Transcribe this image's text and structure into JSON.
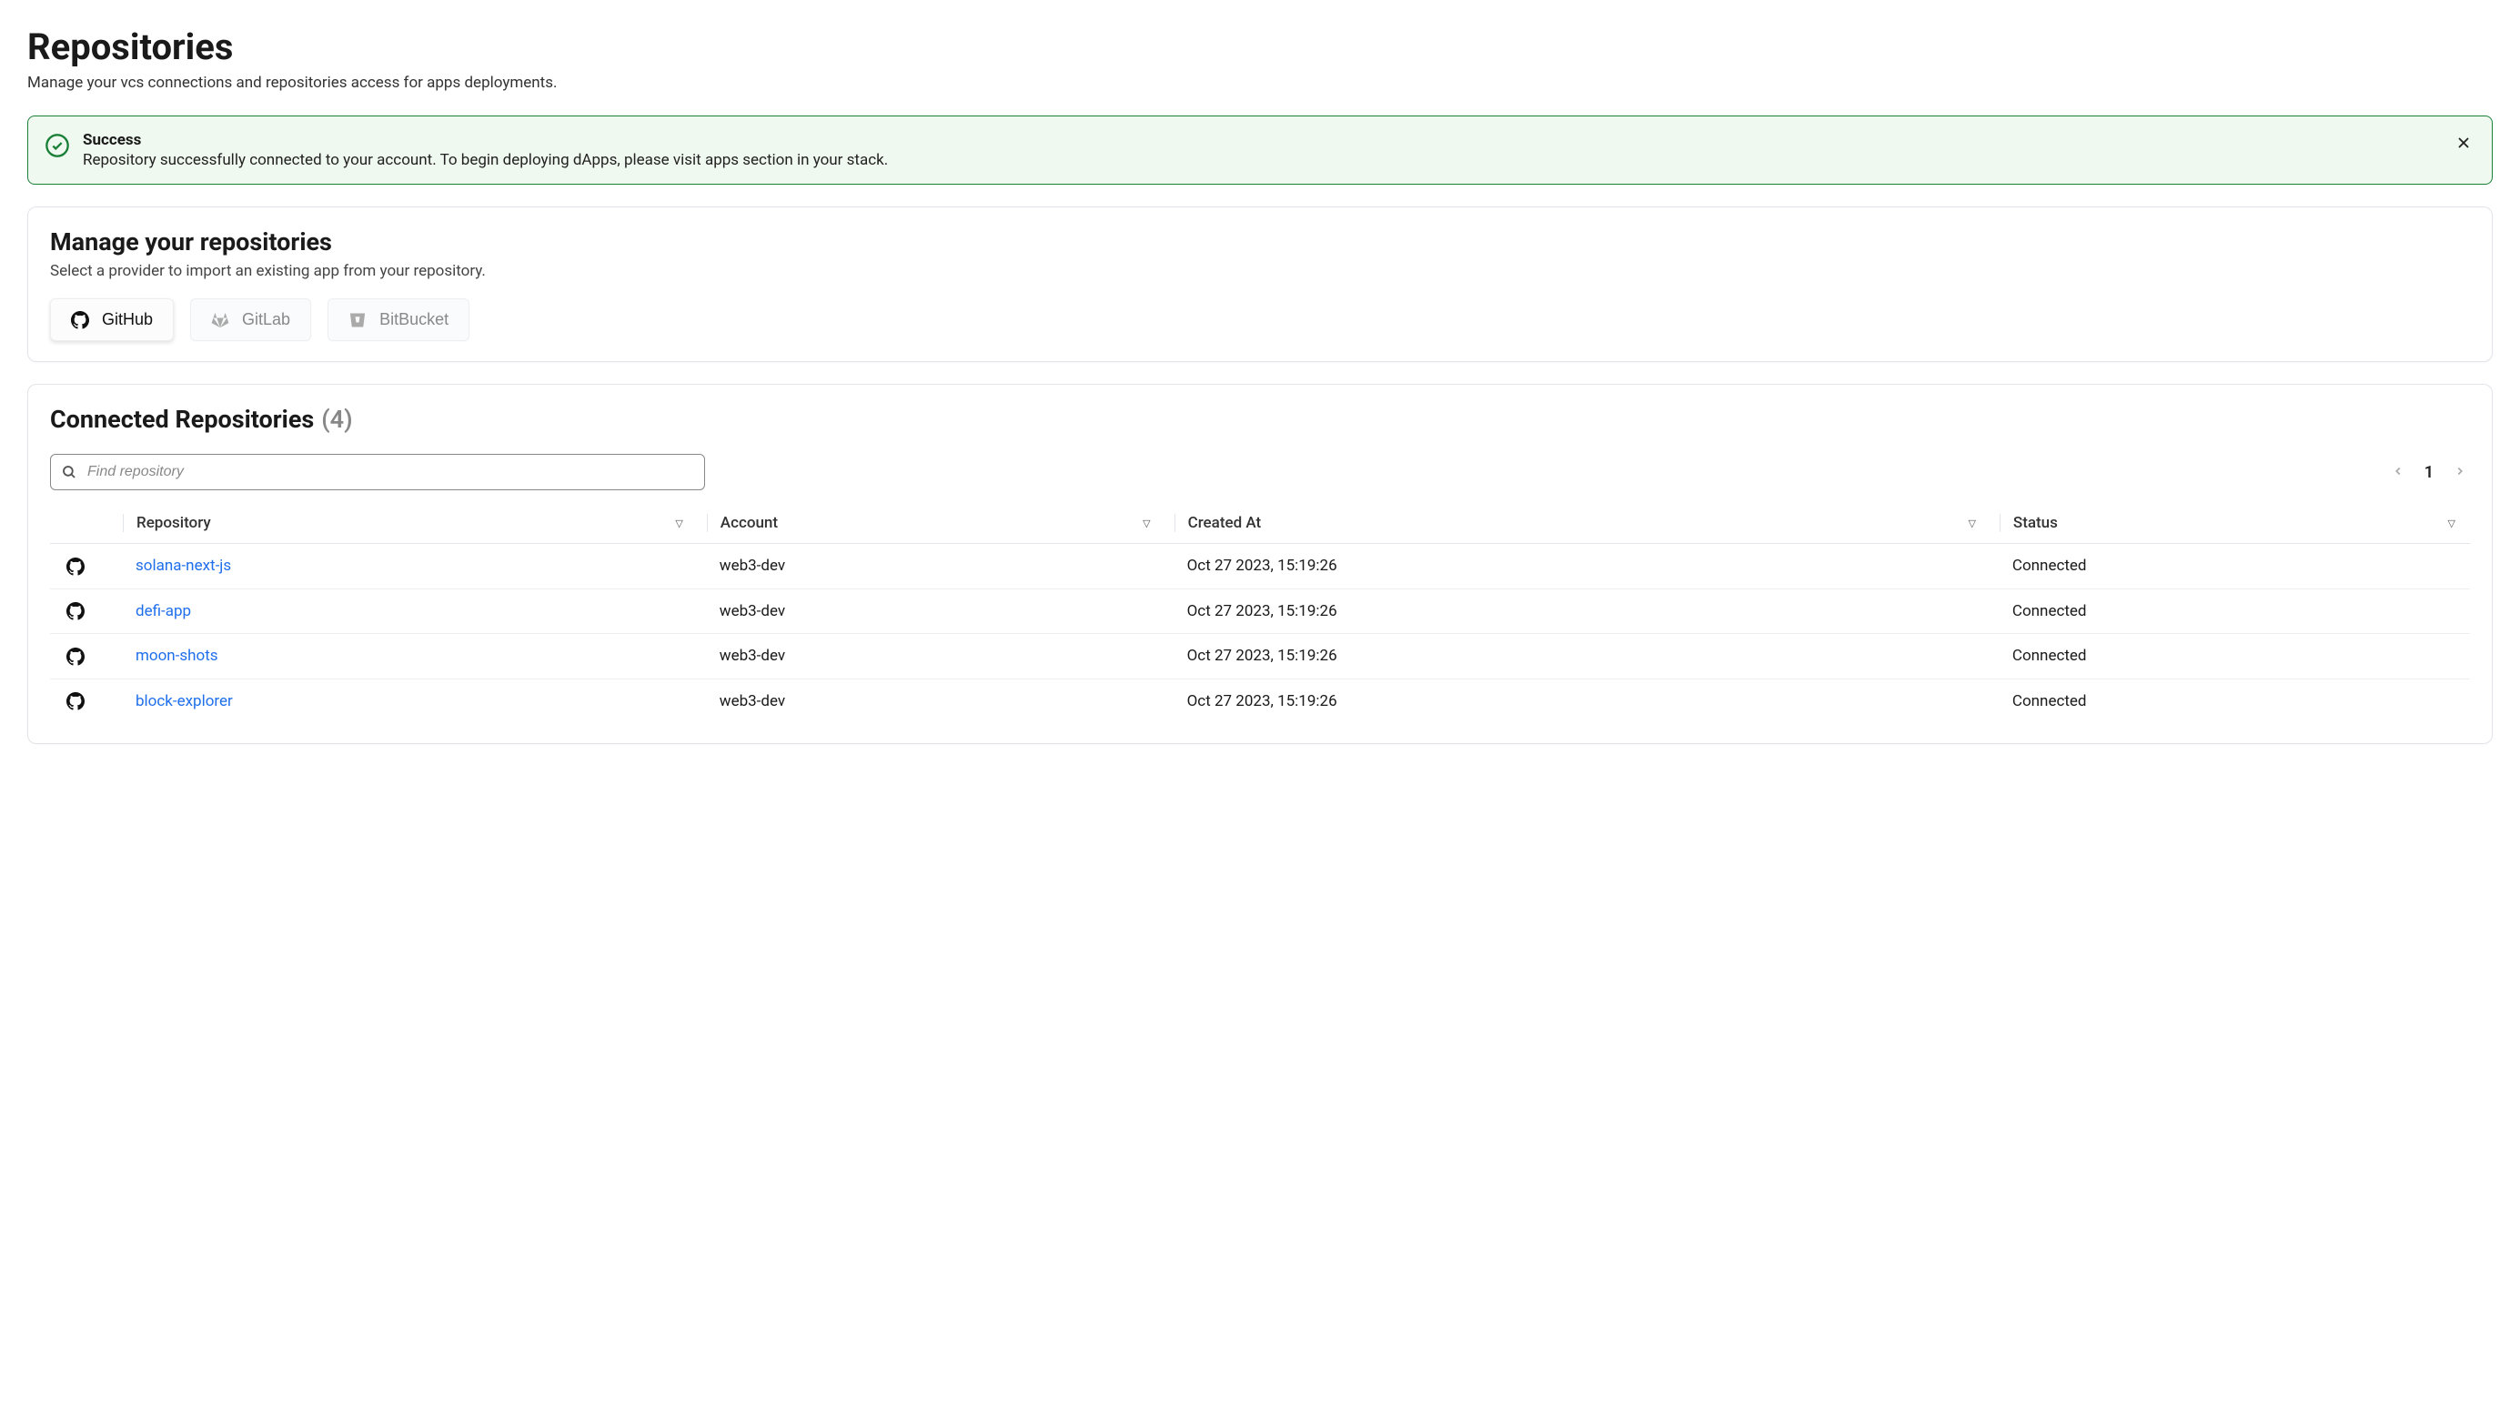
{
  "header": {
    "title": "Repositories",
    "subtitle": "Manage your vcs connections and repositories access for apps deployments."
  },
  "alert": {
    "title": "Success",
    "message": "Repository successfully connected to your account. To begin deploying dApps, please visit apps section in your stack."
  },
  "manage": {
    "title": "Manage your repositories",
    "subtitle": "Select a provider to import an existing app from your repository.",
    "providers": {
      "github": "GitHub",
      "gitlab": "GitLab",
      "bitbucket": "BitBucket"
    }
  },
  "connected": {
    "title": "Connected Repositories",
    "count": "(4)",
    "search_placeholder": "Find repository",
    "page": "1",
    "columns": {
      "repository": "Repository",
      "account": "Account",
      "created_at": "Created At",
      "status": "Status"
    },
    "rows": [
      {
        "name": "solana-next-js",
        "account": "web3-dev",
        "created": "Oct 27 2023, 15:19:26",
        "status": "Connected"
      },
      {
        "name": "defi-app",
        "account": "web3-dev",
        "created": "Oct 27 2023, 15:19:26",
        "status": "Connected"
      },
      {
        "name": "moon-shots",
        "account": "web3-dev",
        "created": "Oct 27 2023, 15:19:26",
        "status": "Connected"
      },
      {
        "name": "block-explorer",
        "account": "web3-dev",
        "created": "Oct 27 2023, 15:19:26",
        "status": "Connected"
      }
    ]
  }
}
